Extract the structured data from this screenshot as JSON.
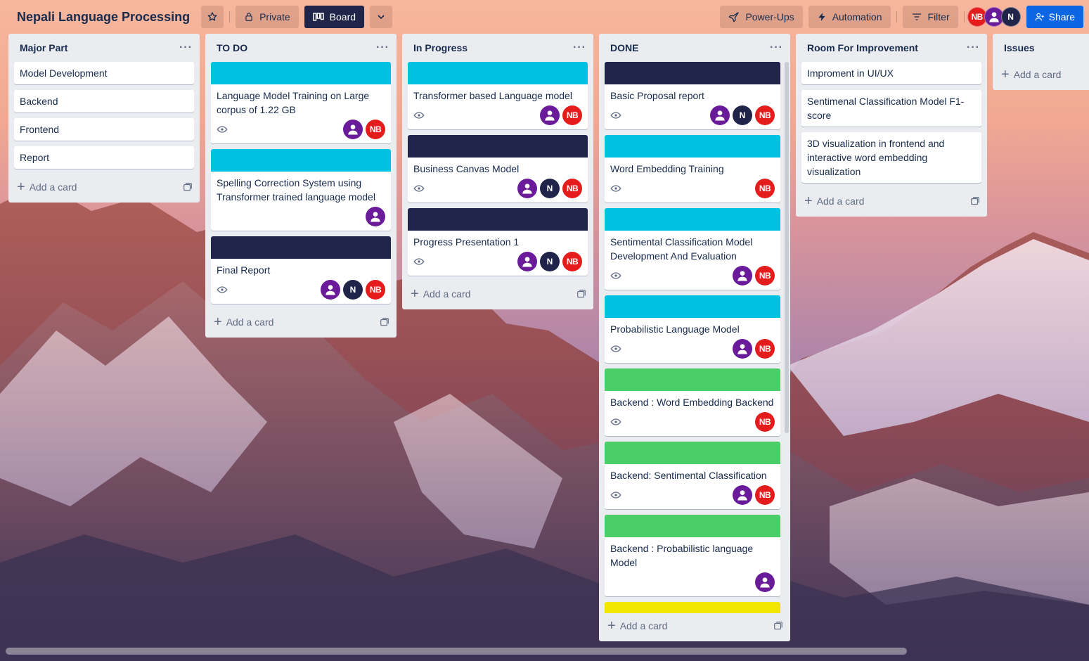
{
  "header": {
    "title": "Nepali Language Processing",
    "visibility": "Private",
    "view": "Board",
    "power_ups": "Power-Ups",
    "automation": "Automation",
    "filter": "Filter",
    "share": "Share",
    "members": [
      "NB",
      "user",
      "N"
    ]
  },
  "colors": {
    "cyan_cover": "#00c2e0",
    "navy_cover": "#1f2448",
    "green_cover": "#4bce68",
    "yellow_cover": "#f2e600",
    "avatar_nb": "#e41c1c",
    "avatar_n": "#1f2448",
    "avatar_user": "#6a1b9a",
    "share": "#0c66e4"
  },
  "add_card_label": "Add a card",
  "lists": [
    {
      "title": "Major Part",
      "cards": [
        {
          "title": "Model Development"
        },
        {
          "title": "Backend"
        },
        {
          "title": "Frontend"
        },
        {
          "title": "Report"
        }
      ]
    },
    {
      "title": "TO DO",
      "cards": [
        {
          "title": "Language Model Training on Large corpus of 1.22 GB",
          "cover": "cyan",
          "watch": true,
          "members": [
            "user",
            "NB"
          ]
        },
        {
          "title": "Spelling Correction System using Transformer trained language model",
          "cover": "cyan",
          "members": [
            "user"
          ]
        },
        {
          "title": "Final Report",
          "cover": "navy",
          "watch": true,
          "members": [
            "user",
            "N",
            "NB"
          ]
        }
      ]
    },
    {
      "title": "In Progress",
      "cards": [
        {
          "title": "Transformer based Language model",
          "cover": "cyan",
          "watch": true,
          "members": [
            "user",
            "NB"
          ]
        },
        {
          "title": "Business Canvas Model",
          "cover": "navy",
          "watch": true,
          "members": [
            "user",
            "N",
            "NB"
          ]
        },
        {
          "title": "Progress Presentation 1",
          "cover": "navy",
          "watch": true,
          "members": [
            "user",
            "N",
            "NB"
          ]
        }
      ]
    },
    {
      "title": "DONE",
      "cards": [
        {
          "title": "Basic Proposal report",
          "cover": "navy",
          "watch": true,
          "members": [
            "user",
            "N",
            "NB"
          ]
        },
        {
          "title": "Word Embedding Training",
          "cover": "cyan",
          "watch": true,
          "members": [
            "NB"
          ]
        },
        {
          "title": "Sentimental Classification Model Development And Evaluation",
          "cover": "cyan",
          "watch": true,
          "members": [
            "user",
            "NB"
          ]
        },
        {
          "title": "Probabilistic Language Model",
          "cover": "cyan",
          "watch": true,
          "members": [
            "user",
            "NB"
          ]
        },
        {
          "title": "Backend : Word Embedding Backend",
          "cover": "green",
          "watch": true,
          "members": [
            "NB"
          ]
        },
        {
          "title": "Backend: Sentimental Classification",
          "cover": "green",
          "watch": true,
          "members": [
            "user",
            "NB"
          ]
        },
        {
          "title": "Backend : Probabilistic language Model",
          "cover": "green",
          "members": [
            "user"
          ]
        },
        {
          "title": "",
          "cover": "yellow"
        }
      ]
    },
    {
      "title": "Room For Improvement",
      "cards": [
        {
          "title": "Improment in UI/UX"
        },
        {
          "title": "Sentimenal Classification Model F1-score"
        },
        {
          "title": "3D visualization in frontend and interactive word embedding visualization"
        }
      ]
    },
    {
      "title": "Issues",
      "cards": []
    }
  ]
}
